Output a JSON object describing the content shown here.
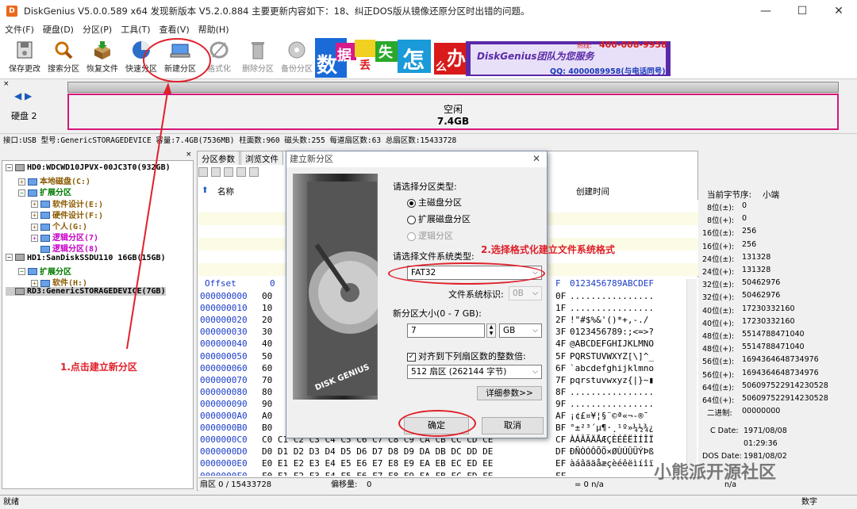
{
  "window": {
    "title": "DiskGenius V5.0.0.589 x64   发现新版本 V5.2.0.884 主要更新内容如下：18、纠正DOS版从镜像还原分区时出错的问题。",
    "app_icon": "D",
    "min": "—",
    "max": "☐",
    "close": "✕"
  },
  "menu": [
    "文件(F)",
    "硬盘(D)",
    "分区(P)",
    "工具(T)",
    "查看(V)",
    "帮助(H)"
  ],
  "toolbar": {
    "save": "保存更改",
    "search": "搜索分区",
    "restore": "恢复文件",
    "quick": "快速分区",
    "newpart": "新建分区",
    "format": "格式化",
    "delete": "删除分区",
    "backup": "备份分区"
  },
  "banner": {
    "chars": [
      "数",
      "据",
      "丢",
      "失",
      "怎",
      "么",
      "办"
    ],
    "slogan": "DiskGenius团队为您服务",
    "phone": "400-008-9958",
    "qq": "QQ: 4000089958(与电话同号)",
    "phone_prefix": "热线:"
  },
  "disk": {
    "label": "硬盘 2",
    "free_label": "空闲",
    "free_size": "7.4GB"
  },
  "infobar": "接口:USB  型号:GenericSTORAGEDEVICE  容量:7.4GB(7536MB)  柱面数:960  磁头数:255  每道扇区数:63  总扇区数:15433728",
  "tree": [
    {
      "indent": 0,
      "box": "⊟",
      "text": "HD0:WDCWD10JPVX-00JC3T0(932GB)",
      "color": "#000",
      "icon": "disk"
    },
    {
      "indent": 1,
      "box": "⊞",
      "text": "本地磁盘(C:)",
      "color": "#8b5a00",
      "icon": "part"
    },
    {
      "indent": 1,
      "box": "⊟",
      "text": "扩展分区",
      "color": "#007a00",
      "icon": "part"
    },
    {
      "indent": 2,
      "box": "⊞",
      "text": "软件设计(E:)",
      "color": "#8b5a00",
      "icon": "part"
    },
    {
      "indent": 2,
      "box": "⊞",
      "text": "硬件设计(F:)",
      "color": "#8b5a00",
      "icon": "part"
    },
    {
      "indent": 2,
      "box": "⊞",
      "text": "个人(G:)",
      "color": "#8b5a00",
      "icon": "part"
    },
    {
      "indent": 2,
      "box": "⊞",
      "text": "逻辑分区(7)",
      "color": "#c800c8",
      "icon": "part"
    },
    {
      "indent": 2,
      "box": "",
      "text": "逻辑分区(8)",
      "color": "#c800c8",
      "icon": "part"
    },
    {
      "indent": 0,
      "box": "⊟",
      "text": "HD1:SanDiskSSDU110 16GB(15GB)",
      "color": "#000",
      "icon": "disk"
    },
    {
      "indent": 1,
      "box": "⊟",
      "text": "扩展分区",
      "color": "#007a00",
      "icon": "part"
    },
    {
      "indent": 2,
      "box": "⊞",
      "text": "软件(H:)",
      "color": "#8b5a00",
      "icon": "part"
    },
    {
      "indent": 0,
      "box": "",
      "text": "RD3:GenericSTORAGEDEVICE(7GB)",
      "color": "#000",
      "icon": "disk",
      "selected": true
    }
  ],
  "tabs": [
    "分区参数",
    "浏览文件"
  ],
  "filehead": {
    "name": "名称",
    "created": "创建时间"
  },
  "hex": {
    "header_offset": "Offset",
    "header_zero": "0",
    "header_f": "F",
    "header_ascii": "0123456789ABCDEF",
    "rows": [
      {
        "off": "000000000",
        "b0": "00",
        "bf": "0F",
        "asc": "................"
      },
      {
        "off": "000000010",
        "b0": "10",
        "bf": "1F",
        "asc": "................"
      },
      {
        "off": "000000020",
        "b0": "20",
        "bf": "2F",
        "asc": " !\"#$%&'()*+,-./"
      },
      {
        "off": "000000030",
        "b0": "30",
        "bf": "3F",
        "asc": "0123456789:;<=>?"
      },
      {
        "off": "000000040",
        "b0": "40",
        "bf": "4F",
        "asc": "@ABCDEFGHIJKLMNO"
      },
      {
        "off": "000000050",
        "b0": "50",
        "bf": "5F",
        "asc": "PQRSTUVWXYZ[\\]^_"
      },
      {
        "off": "000000060",
        "b0": "60",
        "bf": "6F",
        "asc": "`abcdefghijklmno"
      },
      {
        "off": "000000070",
        "b0": "70",
        "bf": "7F",
        "asc": "pqrstuvwxyz{|}~▮"
      },
      {
        "off": "000000080",
        "b0": "80",
        "bf": "8F",
        "asc": "................"
      },
      {
        "off": "000000090",
        "b0": "90",
        "bf": "9F",
        "asc": "................"
      },
      {
        "off": "0000000A0",
        "b0": "A0",
        "bf": "AF",
        "asc": " ¡¢£¤¥¦§¨©ª«¬-®¯"
      },
      {
        "off": "0000000B0",
        "b0": "B0",
        "bf": "BF",
        "asc": "°±²³´µ¶·¸¹º»¼½¾¿"
      },
      {
        "off": "0000000C0",
        "b0": "C0 C1 C2 C3 C4 C5 C6 C7 C8 C9 CA CB CC CD CE",
        "bf": "CF",
        "asc": "ÀÁÂÃÄÅÆÇÈÉÊËÌÍÎÏ"
      },
      {
        "off": "0000000D0",
        "b0": "D0 D1 D2 D3 D4 D5 D6 D7 D8 D9 DA DB DC DD DE",
        "bf": "DF",
        "asc": "ÐÑÒÓÔÕÖ×ØÙÚÛÜÝÞß"
      },
      {
        "off": "0000000E0",
        "b0": "E0 E1 E2 E3 E4 E5 E6 E7 E8 E9 EA EB EC ED EE",
        "bf": "EF",
        "asc": "àáâãäåæçèéêëìíîï"
      },
      {
        "off": "0000000F0",
        "b0": "F0 F1 F2 F3 F4 F5 F6 F7 F8 F9 FA FB FC FD FE",
        "bf": "FF",
        "asc": ""
      }
    ]
  },
  "hexstatus": {
    "sector": "扇区 0 / 15433728",
    "offset_label": "偏移量:",
    "offset_val": "0",
    "right": "= 0 n/a"
  },
  "right": {
    "title": "当前字节序:",
    "title_val": "小端",
    "rows": [
      [
        "8位(±):",
        "0"
      ],
      [
        "8位(+):",
        "0"
      ],
      [
        "16位(±):",
        "256"
      ],
      [
        "16位(+):",
        "256"
      ],
      [
        "24位(±):",
        "131328"
      ],
      [
        "24位(+):",
        "131328"
      ],
      [
        "32位(±):",
        "50462976"
      ],
      [
        "32位(+):",
        "50462976"
      ],
      [
        "40位(±):",
        "17230332160"
      ],
      [
        "40位(+):",
        "17230332160"
      ],
      [
        "48位(±):",
        "5514788471040"
      ],
      [
        "48位(+):",
        "5514788471040"
      ],
      [
        "56位(±):",
        "1694364648734976"
      ],
      [
        "56位(+):",
        "1694364648734976"
      ],
      [
        "64位(±):",
        "506097522914230528"
      ],
      [
        "64位(+):",
        "506097522914230528"
      ],
      [
        "二进制:",
        "00000000"
      ]
    ],
    "cdate_label": "C Date:",
    "cdate": "1971/08/08",
    "ctime": "01:29:36",
    "dosdate_label": "DOS Date:",
    "dosdate": "1981/08/02",
    "na": "n/a"
  },
  "status": {
    "left": "就绪",
    "right": "数字"
  },
  "dialog": {
    "title": "建立新分区",
    "close": "✕",
    "type_label": "请选择分区类型:",
    "primary": "主磁盘分区",
    "extended": "扩展磁盘分区",
    "logical": "逻辑分区",
    "fs_label": "请选择文件系统类型:",
    "fs_value": "FAT32",
    "fsid_label": "文件系统标识:",
    "fsid_value": "0B",
    "size_label": "新分区大小(0 - 7 GB):",
    "size_value": "7",
    "unit": "GB",
    "align_label": "对齐到下列扇区数的整数倍:",
    "align_value": "512 扇区 (262144 字节)",
    "detail": "详细参数>>",
    "ok": "确定",
    "cancel": "取消",
    "brand": "DISK GENIUS"
  },
  "annotations": {
    "step1": "1.点击建立新分区",
    "step2": "2.选择格式化建立文件系统格式",
    "watermark": "小熊派开源社区"
  }
}
